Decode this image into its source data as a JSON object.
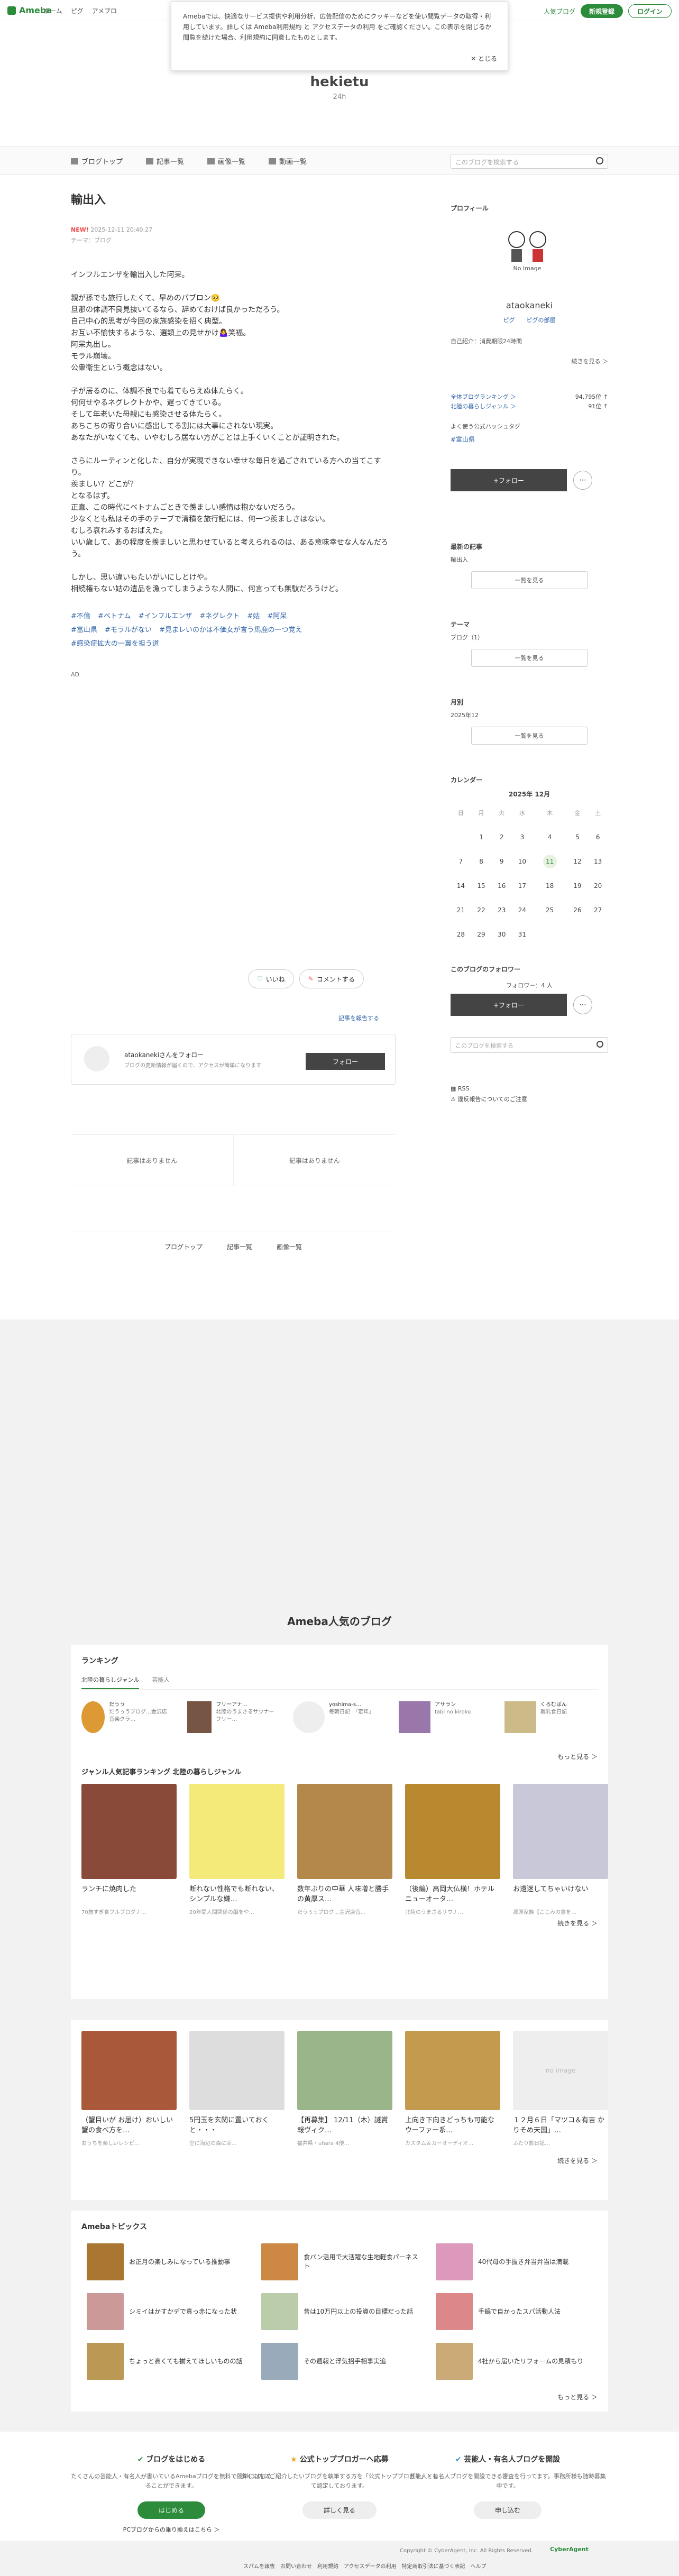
{
  "topbar": {
    "logo": "Ameba",
    "nav": [
      "ホーム",
      "ピグ",
      "アメブロ"
    ],
    "blog_link": "人気ブログ",
    "register": "新規登録",
    "login": "ログイン"
  },
  "cookie": {
    "text": "Amebaでは、快適なサービス提供や利用分析、広告配信のためにクッキーなどを使い閲覧データの取得・利用しています。詳しくは Ameba利用規約 と アクセスデータの利用 をご確認ください。この表示を閉じるか閲覧を続けた場合、利用規約に同意したものとします。",
    "close": "✕ とじる"
  },
  "header": {
    "title": "hekietu",
    "subtitle": "24h"
  },
  "blognav": {
    "items": [
      "ブログトップ",
      "記事一覧",
      "画像一覧",
      "動画一覧"
    ],
    "search_placeholder": "このブログを検索する"
  },
  "article": {
    "title": "輸出入",
    "new_badge": "NEW!",
    "date": "2025-12-11 20:40:27",
    "theme": "テーマ：ブログ",
    "paragraphs": [
      "インフルエンザを輸出入した阿呆。",
      "親が孫でも旅行したくて、早めのパブロン🥺\n旦那の体調不良見抜いてるなら、辞めておけば良かっただろう。\n自己中心的思考が今回の家族感染を招く典型。\nお互い不愉快するような、選類上の見せかけ🤷‍♀️笑福。\n阿呆丸出し。\nモラル崩壊。\n公衆衛生という概念はない。",
      "子が居るのに、体調不良でも着てもらえぬ体たらく。\n何何せやるネグレクトかや、遅ってきている。\nそして年老いた母親にも感染させる体たらく。\nあちこちの寄り合いに感出してる割には大事にされない現実。\nあなたがいなくても、いやむしろ居ない方がことは上手くいくことが証明された。",
      "さらにルーティンと化した、自分が実現できない幸せな毎日を過ごされている方への当てこすり。\n羨ましい？どこが？\nとなるはず。\n正直、この時代にベトナムごときで羨ましい感情は抱かないだろう。\n少なくとも私はその手のテーブで清積を旅行記には、何一つ羨ましさはない。\nむしろ哀れみするおばえた。\nいい歳して、あの程度を羨ましいと思わせていると考えられるのは、ある意味幸せな人なんだろう。",
      "しかし、思い違いもたいがいにしとけや。\n相続権もない姑の遺品を漁ってしまうような人間に、何言っても無駄だろうけど。"
    ],
    "tags": [
      "#不倫",
      "#ベトナム",
      "#インフルエンザ",
      "#ネグレクト",
      "#姑",
      "#阿呆",
      "#富山県",
      "#モラルがない",
      "#見まレいのかは不価女が言う馬鹿の一つ覚え",
      "#感染症拡大の一翼を担う道"
    ],
    "ad": "AD",
    "like": "いいね",
    "comment": "コメントする",
    "report": "記事を報告する"
  },
  "followcard": {
    "title": "ataokanekiさんをフォロー",
    "subtitle": "ブログの更新情報が届くので、アクセスが簡単になります",
    "button": "フォロー"
  },
  "prevnext": {
    "prev": "記事はありません",
    "next": "記事はありません"
  },
  "bottomnav": [
    "ブログトップ",
    "記事一覧",
    "画像一覧"
  ],
  "sidebar": {
    "profile_h": "プロフィール",
    "noimage": "No Image",
    "name": "ataokaneki",
    "links": "ピグ　　ピグの部屋",
    "intro": "自己紹介：消費期限24時間",
    "more": "続きを見る ＞",
    "rank1_label": "全体ブログランキング ＞",
    "rank1_val": "94,795位 ↑",
    "rank2_label": "北陸の暮らしジャンル ＞",
    "rank2_val": "91位 ↑",
    "hash_h": "よく使う公式ハッシュタグ",
    "hash": "#富山県",
    "follow": "+フォロー",
    "dots": "⋯",
    "latest_h": "最新の記事",
    "latest_item": "輸出入",
    "list_btn": "一覧を見る",
    "theme_h": "テーマ",
    "theme_item": "ブログ（1）",
    "month_h": "月別",
    "month_item": "2025年12",
    "cal_h": "カレンダー",
    "cal_title": "2025年 12月",
    "weekdays": [
      "日",
      "月",
      "火",
      "水",
      "木",
      "金",
      "土"
    ],
    "weeks": [
      [
        "",
        "1",
        "2",
        "3",
        "4",
        "5",
        "6"
      ],
      [
        "7",
        "8",
        "9",
        "10",
        "11",
        "12",
        "13"
      ],
      [
        "14",
        "15",
        "16",
        "17",
        "18",
        "19",
        "20"
      ],
      [
        "21",
        "22",
        "23",
        "24",
        "25",
        "26",
        "27"
      ],
      [
        "28",
        "29",
        "30",
        "31",
        "",
        "",
        ""
      ]
    ],
    "followers_h": "このブログのフォロワー",
    "followers": "フォロワー：4 人",
    "search_placeholder": "このブログを検索する",
    "rss": "RSS",
    "violation": "違反報告についてのご注意"
  },
  "popular": {
    "title": "Ameba人気のブログ",
    "ranking_h": "ランキング",
    "tab1": "北陸の暮らしジャンル",
    "tab2": "芸能人",
    "bloggers": [
      {
        "name": "だうう",
        "desc": "だうぅうブログ…金沢店音楽クラ…"
      },
      {
        "name": "フリーアナ…",
        "desc": "北陸のうまさるサウナーフリー…"
      },
      {
        "name": "yoshima-s…",
        "desc": "毎朝日記　「定年」"
      },
      {
        "name": "アサラン",
        "desc": "tabi no kiroku"
      },
      {
        "name": "くろむばん",
        "desc": "離乳食日記"
      }
    ],
    "more": "もっと見る ＞",
    "genre_h": "ジャンル人気記事ランキング 北陸の暮らしジャンル",
    "articles": [
      {
        "title": "ランチに焼肉した",
        "sub": "70歳すぎ食フルブログナ…"
      },
      {
        "title": "断れない性格でも断れない、シンプルな嫌…",
        "sub": "20年間人間関係の脳をや…"
      },
      {
        "title": "数年ぶりの中華 人味噌と勝手の黄厚ス…",
        "sub": "だうぅうブログ…金沢店音…"
      },
      {
        "title": "（後編）高岡大仏横！ホテルニューオータ…",
        "sub": "北陸のうまさるサウナ…"
      },
      {
        "title": "お遠迷してちゃいけない",
        "sub": "那原家族【ここみの意を…"
      }
    ],
    "cont": "続きを見る ＞",
    "articles2": [
      {
        "title": "（蟹目いが お届け）おいしい蟹の食べ方を…",
        "sub": "おうちを楽しいレシピ…"
      },
      {
        "title": "5円玉を玄関に置いておくと・・・",
        "sub": "空に海辺の森に幸…"
      },
      {
        "title": "【再募集】 12/11（木）謎賞報ヴィク…",
        "sub": "福井県・uhara 4便…"
      },
      {
        "title": "上向き下向きどっちも可能なウーファー系…",
        "sub": "カスタム＆カーオーディオ…"
      },
      {
        "title": "１２月６日「マツコ＆有吉 かりそめ天国」…",
        "sub": "ふたり旅日記…"
      }
    ],
    "noimage": "no image",
    "cont2": "続きを見る ＞",
    "topics_h": "Amebaトピックス",
    "topics": [
      "お正月の楽しみになっている推動事",
      "食パン活用で大活躍な生地軽食パーネスト",
      "40代母の手抜き弁当弁当は満載",
      "シミイはかすかデで真っ赤になった状",
      "昔は10万円以上の投資の目標だった話",
      "手鍋で自かったスパ活動人法",
      "ちょっと高くても揃えてほしいものの話",
      "その週報と浮気招手相事実追",
      "4社から届いたリフォームの見積もり"
    ],
    "topics_more": "もっと見る ＞"
  },
  "promo": {
    "c1_h": "ブログをはじめる",
    "c1_d": "たくさんの芸能人・有名人が書いているAmebaブログを無料で簡単にはじめることができます。",
    "c1_b": "はじめる",
    "c1_l": "PCブログからの乗り換えはこちら ＞",
    "c2_h": "公式トップブロガーへ応募",
    "c2_d": "多くの方にご紹介したいブログを執筆する方を「公式トップブロガー」として認定しております。",
    "c2_b": "詳しく見る",
    "c3_h": "芸能人・有名人ブログを開設",
    "c3_d": "芸能人・有名人ブログを開設できる審査を行ってます。事務所様も随時募集中です。",
    "c3_b": "申し込む"
  },
  "footer": {
    "copyright": "Copyright © CyberAgent, Inc. All Rights Reserved.",
    "brand": "CyberAgent",
    "links": "スパムを報告　お問い合わせ　利用規約　アクセスデータの利用　特定商取引法に基づく表記　ヘルプ"
  },
  "colors": {
    "accent": "#2d8c3c",
    "link": "#3366aa",
    "tag": "#3366aa"
  }
}
